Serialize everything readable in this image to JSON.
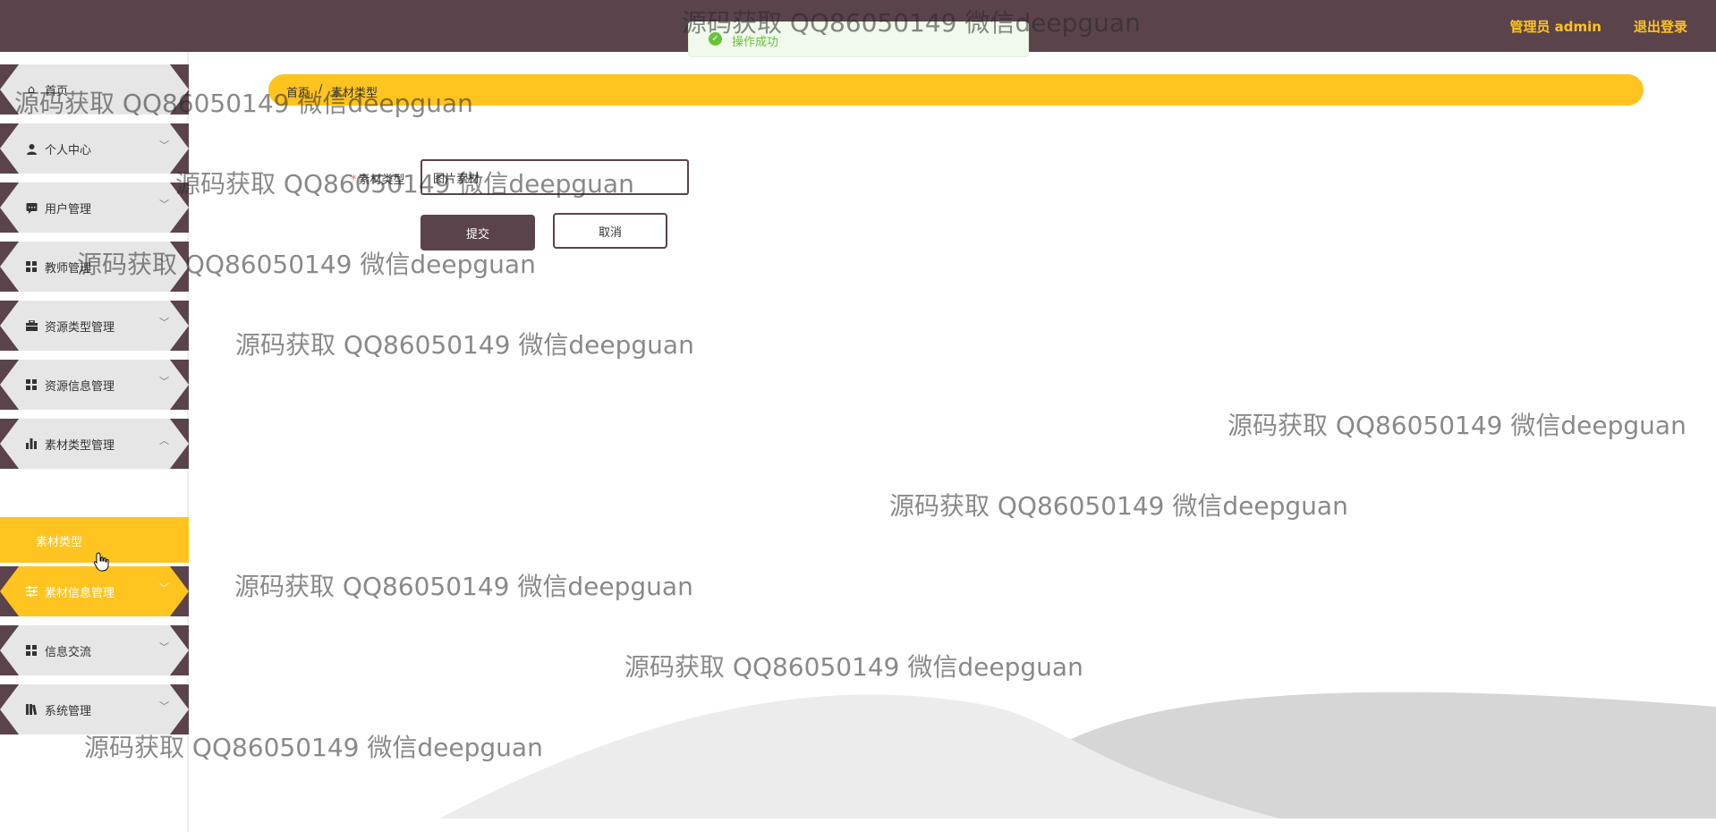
{
  "header": {
    "user_label": "管理员 admin",
    "logout_label": "退出登录"
  },
  "toast": {
    "message": "操作成功"
  },
  "sidebar": {
    "items": [
      {
        "label": "首页",
        "icon": "home-icon"
      },
      {
        "label": "个人中心",
        "icon": "user-icon"
      },
      {
        "label": "用户管理",
        "icon": "chat-icon"
      },
      {
        "label": "教师管理",
        "icon": "grid-icon"
      },
      {
        "label": "资源类型管理",
        "icon": "briefcase-icon"
      },
      {
        "label": "资源信息管理",
        "icon": "grid-icon"
      },
      {
        "label": "素材类型管理",
        "icon": "bar-chart-icon"
      },
      {
        "label": "素材信息管理",
        "icon": "sliders-icon"
      },
      {
        "label": "信息交流",
        "icon": "grid-icon"
      },
      {
        "label": "系统管理",
        "icon": "library-icon"
      }
    ],
    "sub_item": "素材类型"
  },
  "breadcrumb": {
    "home": "首页",
    "separator": "/",
    "current": "素材类型"
  },
  "form": {
    "field_label": "素材类型",
    "field_value": "图片素材",
    "submit_label": "提交",
    "cancel_label": "取消"
  },
  "watermark": "源码获取 QQ86050149 微信deepguan",
  "colors": {
    "header_bg": "#5b434c",
    "accent": "#ffc41f",
    "menu_bg": "#e6e6e6",
    "success": "#67c23a"
  }
}
